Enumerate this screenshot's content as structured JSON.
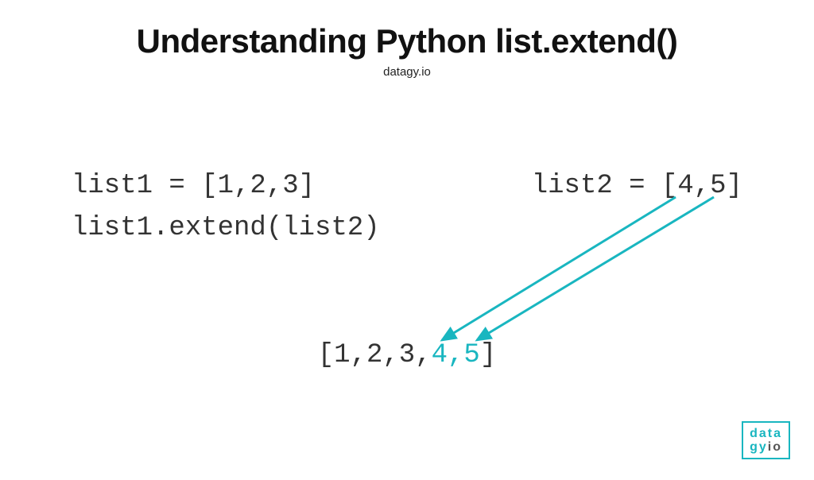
{
  "header": {
    "title": "Understanding Python list.extend()",
    "subtitle": "datagy.io"
  },
  "code": {
    "line1_left": "list1 = [1,2,3]",
    "line1_right": "list2 = [4,5]",
    "line2": "list1.extend(list2)"
  },
  "result": {
    "open": "[",
    "original": "1,2,3,",
    "extended": "4,5",
    "close": "]"
  },
  "logo": {
    "row1": "data",
    "row2a": "gy",
    "row2b": "io"
  },
  "colors": {
    "accent": "#19b6c0"
  }
}
